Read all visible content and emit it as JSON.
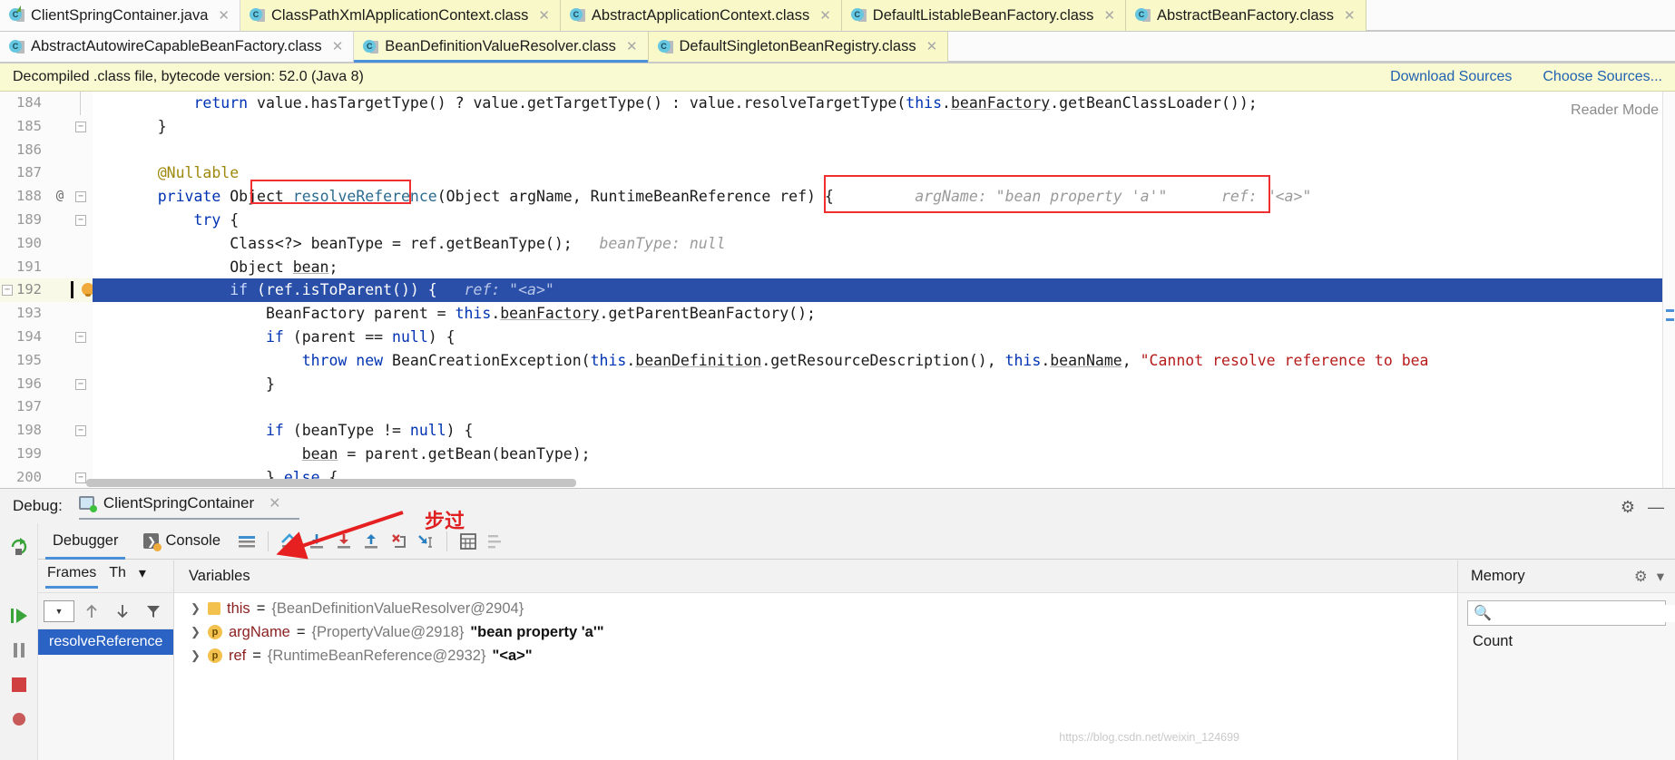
{
  "tabs_row1": [
    {
      "label": "ClientSpringContainer.java",
      "icon": "java-file-icon",
      "state": "plain"
    },
    {
      "label": "ClassPathXmlApplicationContext.class",
      "icon": "class-file-icon",
      "state": "yellow"
    },
    {
      "label": "AbstractApplicationContext.class",
      "icon": "class-file-icon",
      "state": "yellow"
    },
    {
      "label": "DefaultListableBeanFactory.class",
      "icon": "class-file-icon",
      "state": "yellow"
    },
    {
      "label": "AbstractBeanFactory.class",
      "icon": "class-file-icon",
      "state": "yellow"
    }
  ],
  "tabs_row2": [
    {
      "label": "AbstractAutowireCapableBeanFactory.class",
      "icon": "class-file-icon",
      "state": "yellow"
    },
    {
      "label": "BeanDefinitionValueResolver.class",
      "icon": "class-file-icon",
      "state": "active"
    },
    {
      "label": "DefaultSingletonBeanRegistry.class",
      "icon": "class-file-icon",
      "state": "yellow"
    }
  ],
  "notice": {
    "text": "Decompiled .class file, bytecode version: 52.0 (Java 8)",
    "download_sources": "Download Sources",
    "choose_sources": "Choose Sources..."
  },
  "editor": {
    "reader_mode": "Reader Mode",
    "current_line": 192,
    "inline_hint_box": "argName: \"bean property 'a'\"      ref: \"<a>\"",
    "highlight_token": "resolveReference",
    "lines": [
      {
        "no": "184",
        "at": "",
        "fold": "",
        "text": "        return value.hasTargetType() ? value.getTargetType() : value.resolveTargetType(this.beanFactory.getBeanClassLoader());"
      },
      {
        "no": "185",
        "at": "",
        "fold": "end",
        "text": "    }"
      },
      {
        "no": "186",
        "at": "",
        "fold": "",
        "text": ""
      },
      {
        "no": "187",
        "at": "",
        "fold": "",
        "text": "    @Nullable"
      },
      {
        "no": "188",
        "at": "@",
        "fold": "open",
        "text": "    private Object resolveReference(Object argName, RuntimeBeanReference ref) {"
      },
      {
        "no": "189",
        "at": "",
        "fold": "open",
        "text": "        try {"
      },
      {
        "no": "190",
        "at": "",
        "fold": "",
        "text": "            Class<?> beanType = ref.getBeanType();",
        "hint": "beanType: null"
      },
      {
        "no": "191",
        "at": "",
        "fold": "",
        "text": "            Object bean;"
      },
      {
        "no": "192",
        "at": "",
        "fold": "open",
        "text": "            if (ref.isToParent()) {",
        "hint": "ref: \"<a>\"",
        "current": true
      },
      {
        "no": "193",
        "at": "",
        "fold": "",
        "text": "                BeanFactory parent = this.beanFactory.getParentBeanFactory();"
      },
      {
        "no": "194",
        "at": "",
        "fold": "open",
        "text": "                if (parent == null) {"
      },
      {
        "no": "195",
        "at": "",
        "fold": "",
        "text": "                    throw new BeanCreationException(this.beanDefinition.getResourceDescription(), this.beanName, \"Cannot resolve reference to bea"
      },
      {
        "no": "196",
        "at": "",
        "fold": "end",
        "text": "                }"
      },
      {
        "no": "197",
        "at": "",
        "fold": "",
        "text": ""
      },
      {
        "no": "198",
        "at": "",
        "fold": "open",
        "text": "                if (beanType != null) {"
      },
      {
        "no": "199",
        "at": "",
        "fold": "",
        "text": "                    bean = parent.getBean(beanType);"
      },
      {
        "no": "200",
        "at": "",
        "fold": "end",
        "text": "                } else {"
      }
    ]
  },
  "debug": {
    "label": "Debug:",
    "config_name": "ClientSpringContainer",
    "close_x": "×",
    "gear_icon": "gear-icon",
    "minimize_icon": "minimize-icon",
    "tabs": [
      {
        "label": "Debugger",
        "selected": true
      },
      {
        "label": "Console",
        "selected": false
      }
    ],
    "toolbar_icons": [
      "show-execution-point-icon",
      "step-over-icon",
      "step-into-icon",
      "force-step-into-icon",
      "step-out-icon",
      "drop-frame-icon",
      "run-to-cursor-icon",
      "evaluate-expression-icon",
      "layout-icon"
    ],
    "annotation_note": "步过",
    "annotation_color": "#e02020",
    "frames": {
      "tab_frames": "Frames",
      "tab_threads": "Th",
      "dropdown_icon": "chevron-down-icon",
      "toolbar_icons": [
        "thread-selector-icon",
        "up-arrow-icon",
        "down-arrow-icon",
        "filter-icon",
        "add-icon",
        "remove-icon"
      ],
      "selected_frame": "resolveReference"
    },
    "variables": {
      "title": "Variables",
      "rows": [
        {
          "icon": "object-icon",
          "name": "this",
          "eq": "=",
          "ref": "{BeanDefinitionValueResolver@2904}",
          "value": ""
        },
        {
          "icon": "parameter-icon",
          "name": "argName",
          "eq": "=",
          "ref": "{PropertyValue@2918}",
          "value": "\"bean property 'a'\""
        },
        {
          "icon": "parameter-icon",
          "name": "ref",
          "eq": "=",
          "ref": "{RuntimeBeanReference@2932}",
          "value": "\"<a>\""
        }
      ]
    },
    "memory": {
      "title": "Memory",
      "count_label": "Count",
      "search_placeholder": "",
      "search_icon": "search-icon",
      "chevron_icon": "chevron-down-icon",
      "settings_icon": "gear-icon"
    }
  },
  "watermark": "https://blog.csdn.net/weixin_124699",
  "colors": {
    "accent": "#4a90d9",
    "annotation_red": "#f03030",
    "current_line_bg": "#2a4fa8",
    "tab_yellow": "#f8f8c8",
    "keyword_blue": "#0033b3"
  }
}
